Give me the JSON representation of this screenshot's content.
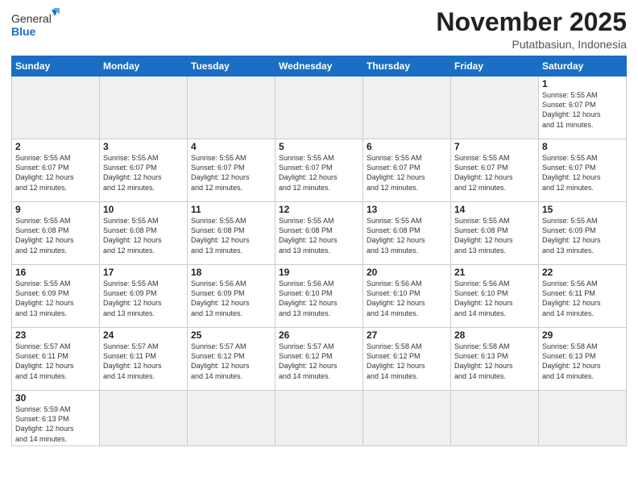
{
  "logo": {
    "general": "General",
    "blue": "Blue"
  },
  "header": {
    "month": "November 2025",
    "location": "Putatbasiun, Indonesia"
  },
  "weekdays": [
    "Sunday",
    "Monday",
    "Tuesday",
    "Wednesday",
    "Thursday",
    "Friday",
    "Saturday"
  ],
  "weeks": [
    [
      {
        "day": "",
        "info": ""
      },
      {
        "day": "",
        "info": ""
      },
      {
        "day": "",
        "info": ""
      },
      {
        "day": "",
        "info": ""
      },
      {
        "day": "",
        "info": ""
      },
      {
        "day": "",
        "info": ""
      },
      {
        "day": "1",
        "info": "Sunrise: 5:55 AM\nSunset: 6:07 PM\nDaylight: 12 hours\nand 11 minutes."
      }
    ],
    [
      {
        "day": "2",
        "info": "Sunrise: 5:55 AM\nSunset: 6:07 PM\nDaylight: 12 hours\nand 12 minutes."
      },
      {
        "day": "3",
        "info": "Sunrise: 5:55 AM\nSunset: 6:07 PM\nDaylight: 12 hours\nand 12 minutes."
      },
      {
        "day": "4",
        "info": "Sunrise: 5:55 AM\nSunset: 6:07 PM\nDaylight: 12 hours\nand 12 minutes."
      },
      {
        "day": "5",
        "info": "Sunrise: 5:55 AM\nSunset: 6:07 PM\nDaylight: 12 hours\nand 12 minutes."
      },
      {
        "day": "6",
        "info": "Sunrise: 5:55 AM\nSunset: 6:07 PM\nDaylight: 12 hours\nand 12 minutes."
      },
      {
        "day": "7",
        "info": "Sunrise: 5:55 AM\nSunset: 6:07 PM\nDaylight: 12 hours\nand 12 minutes."
      },
      {
        "day": "8",
        "info": "Sunrise: 5:55 AM\nSunset: 6:07 PM\nDaylight: 12 hours\nand 12 minutes."
      }
    ],
    [
      {
        "day": "9",
        "info": "Sunrise: 5:55 AM\nSunset: 6:08 PM\nDaylight: 12 hours\nand 12 minutes."
      },
      {
        "day": "10",
        "info": "Sunrise: 5:55 AM\nSunset: 6:08 PM\nDaylight: 12 hours\nand 12 minutes."
      },
      {
        "day": "11",
        "info": "Sunrise: 5:55 AM\nSunset: 6:08 PM\nDaylight: 12 hours\nand 13 minutes."
      },
      {
        "day": "12",
        "info": "Sunrise: 5:55 AM\nSunset: 6:08 PM\nDaylight: 12 hours\nand 13 minutes."
      },
      {
        "day": "13",
        "info": "Sunrise: 5:55 AM\nSunset: 6:08 PM\nDaylight: 12 hours\nand 13 minutes."
      },
      {
        "day": "14",
        "info": "Sunrise: 5:55 AM\nSunset: 6:08 PM\nDaylight: 12 hours\nand 13 minutes."
      },
      {
        "day": "15",
        "info": "Sunrise: 5:55 AM\nSunset: 6:09 PM\nDaylight: 12 hours\nand 13 minutes."
      }
    ],
    [
      {
        "day": "16",
        "info": "Sunrise: 5:55 AM\nSunset: 6:09 PM\nDaylight: 12 hours\nand 13 minutes."
      },
      {
        "day": "17",
        "info": "Sunrise: 5:55 AM\nSunset: 6:09 PM\nDaylight: 12 hours\nand 13 minutes."
      },
      {
        "day": "18",
        "info": "Sunrise: 5:56 AM\nSunset: 6:09 PM\nDaylight: 12 hours\nand 13 minutes."
      },
      {
        "day": "19",
        "info": "Sunrise: 5:56 AM\nSunset: 6:10 PM\nDaylight: 12 hours\nand 13 minutes."
      },
      {
        "day": "20",
        "info": "Sunrise: 5:56 AM\nSunset: 6:10 PM\nDaylight: 12 hours\nand 14 minutes."
      },
      {
        "day": "21",
        "info": "Sunrise: 5:56 AM\nSunset: 6:10 PM\nDaylight: 12 hours\nand 14 minutes."
      },
      {
        "day": "22",
        "info": "Sunrise: 5:56 AM\nSunset: 6:11 PM\nDaylight: 12 hours\nand 14 minutes."
      }
    ],
    [
      {
        "day": "23",
        "info": "Sunrise: 5:57 AM\nSunset: 6:11 PM\nDaylight: 12 hours\nand 14 minutes."
      },
      {
        "day": "24",
        "info": "Sunrise: 5:57 AM\nSunset: 6:11 PM\nDaylight: 12 hours\nand 14 minutes."
      },
      {
        "day": "25",
        "info": "Sunrise: 5:57 AM\nSunset: 6:12 PM\nDaylight: 12 hours\nand 14 minutes."
      },
      {
        "day": "26",
        "info": "Sunrise: 5:57 AM\nSunset: 6:12 PM\nDaylight: 12 hours\nand 14 minutes."
      },
      {
        "day": "27",
        "info": "Sunrise: 5:58 AM\nSunset: 6:12 PM\nDaylight: 12 hours\nand 14 minutes."
      },
      {
        "day": "28",
        "info": "Sunrise: 5:58 AM\nSunset: 6:13 PM\nDaylight: 12 hours\nand 14 minutes."
      },
      {
        "day": "29",
        "info": "Sunrise: 5:58 AM\nSunset: 6:13 PM\nDaylight: 12 hours\nand 14 minutes."
      }
    ],
    [
      {
        "day": "30",
        "info": "Sunrise: 5:59 AM\nSunset: 6:13 PM\nDaylight: 12 hours\nand 14 minutes."
      },
      {
        "day": "",
        "info": ""
      },
      {
        "day": "",
        "info": ""
      },
      {
        "day": "",
        "info": ""
      },
      {
        "day": "",
        "info": ""
      },
      {
        "day": "",
        "info": ""
      },
      {
        "day": "",
        "info": ""
      }
    ]
  ]
}
